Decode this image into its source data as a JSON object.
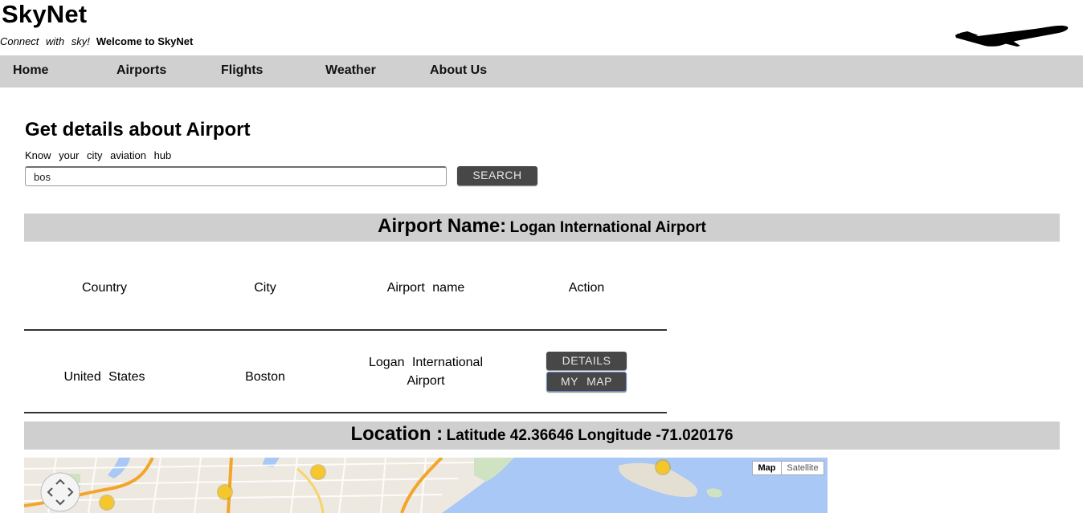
{
  "header": {
    "title": "SkyNet",
    "tagline": "Connect with sky!",
    "welcome": "Welcome to SkyNet",
    "logo_icon": "airplane-icon"
  },
  "nav": {
    "items": [
      {
        "label": "Home"
      },
      {
        "label": "Airports"
      },
      {
        "label": "Flights"
      },
      {
        "label": "Weather"
      },
      {
        "label": "About Us"
      }
    ]
  },
  "search": {
    "title": "Get details about Airport",
    "subtitle": "Know your city aviation hub",
    "value": "bos",
    "button_label": "SEARCH"
  },
  "airport": {
    "label": "Airport Name:",
    "name": "Logan International Airport"
  },
  "table": {
    "headers": [
      "Country",
      "City",
      "Airport name",
      "Action"
    ],
    "rows": [
      {
        "country": "United States",
        "city": "Boston",
        "airport_name": "Logan International Airport",
        "actions": [
          "DETAILS",
          "MY MAP"
        ]
      }
    ]
  },
  "location": {
    "label": "Location :",
    "coords": "Latitude 42.36646 Longitude -71.020176"
  },
  "map": {
    "type_options": [
      "Map",
      "Satellite"
    ],
    "selected_type": "Map",
    "marker_icon": "weather-sun-icon",
    "pan_icon": "pan-control-icon",
    "colors": {
      "land": "#eee9e0",
      "water": "#a9c8f5",
      "park": "#cfe3c3",
      "highway": "#f2a52a",
      "marker": "#f5c72b"
    }
  },
  "colors": {
    "nav_bg": "#d0d0d0",
    "band_bg": "#cfcfcf",
    "button_bg": "#474747"
  }
}
